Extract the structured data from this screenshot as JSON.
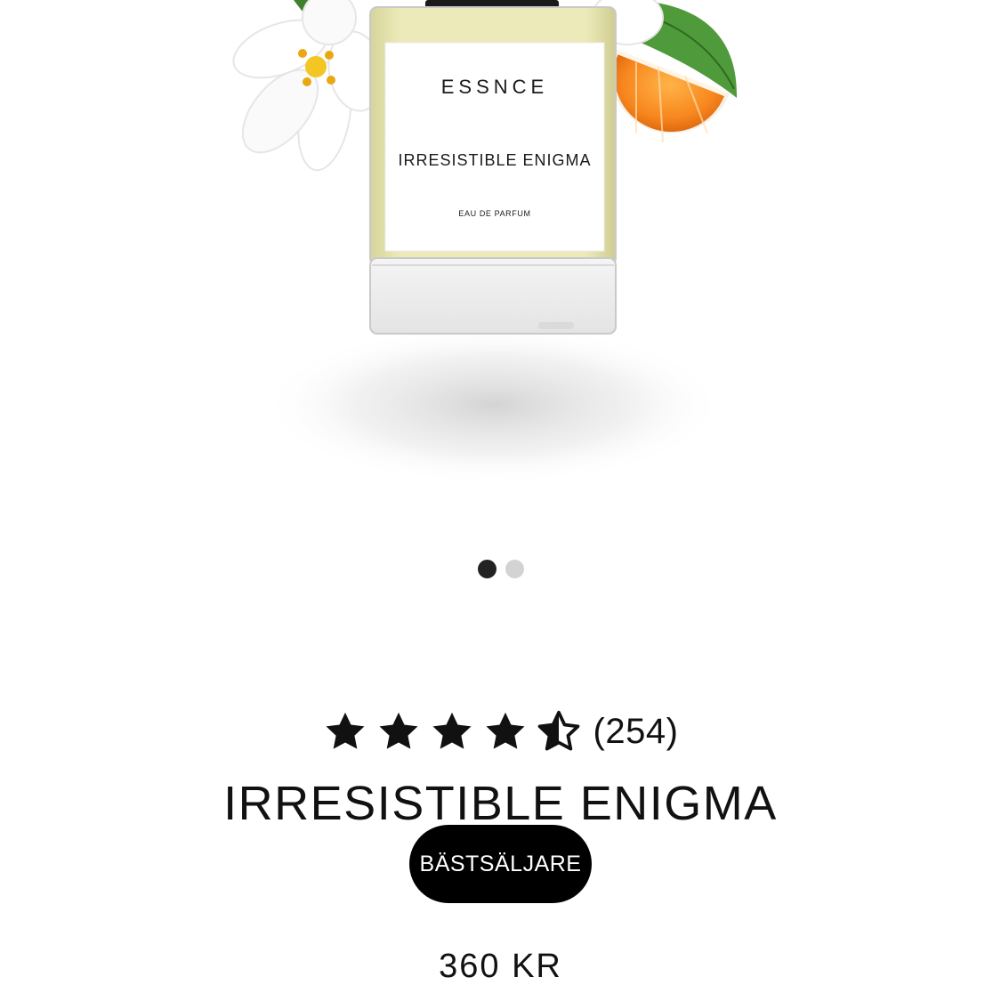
{
  "product_image": {
    "brand": "ESSNCE",
    "label_name": "IRRESISTIBLE ENIGMA",
    "label_type": "EAU DE PARFUM"
  },
  "carousel": {
    "total": 2,
    "active_index": 0
  },
  "rating": {
    "stars": 4.5,
    "max": 5,
    "count_text": "(254)"
  },
  "product": {
    "title": "IRRESISTIBLE ENIGMA",
    "badge": "BÄSTSÄLJARE",
    "price": "360 KR"
  },
  "colors": {
    "accent": "#000000",
    "star": "#111111",
    "inactive_dot": "#d3d3d3"
  }
}
